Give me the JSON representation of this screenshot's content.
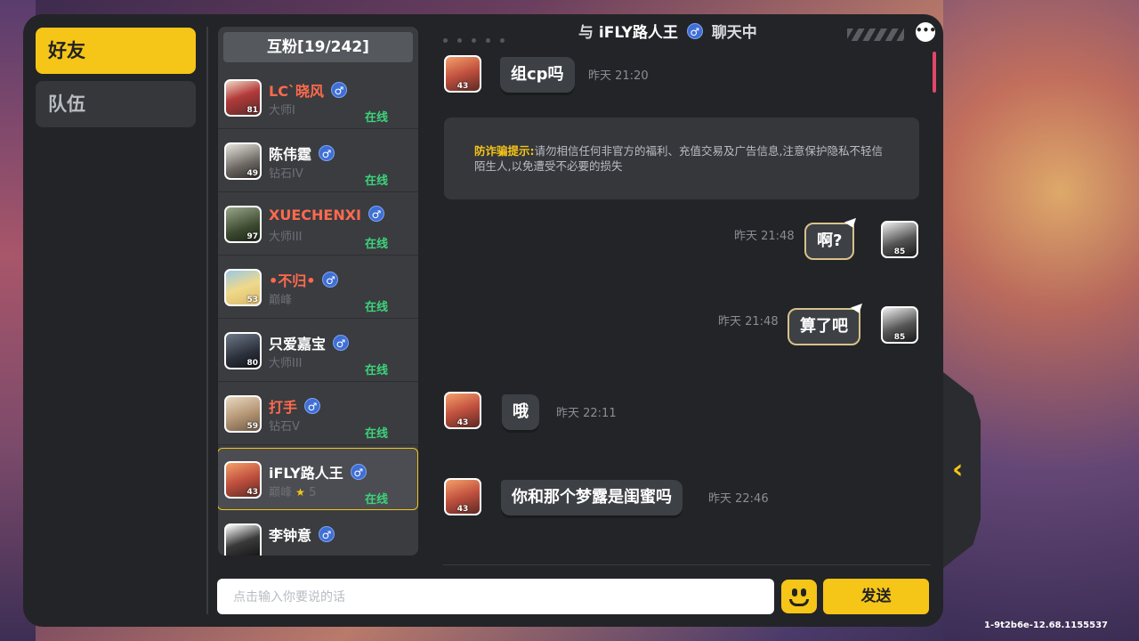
{
  "tabs": {
    "friends": "好友",
    "team": "队伍"
  },
  "friend_list": {
    "header": "互粉[19/242]",
    "friends": [
      {
        "name": "LC`晓风",
        "rank": "大师I",
        "status": "在线",
        "level": "81",
        "name_color": "red",
        "selected": false
      },
      {
        "name": "陈伟霆",
        "rank": "钻石IV",
        "status": "在线",
        "level": "49",
        "name_color": "white",
        "selected": false
      },
      {
        "name": "XUECHENXI",
        "rank": "大师III",
        "status": "在线",
        "level": "97",
        "name_color": "red",
        "selected": false
      },
      {
        "name": "•不归•",
        "rank": "巅峰",
        "status": "在线",
        "level": "53",
        "name_color": "red",
        "selected": false
      },
      {
        "name": "只爱嘉宝",
        "rank": "大师III",
        "status": "在线",
        "level": "80",
        "name_color": "white",
        "selected": false
      },
      {
        "name": "打手",
        "rank": "钻石V",
        "status": "在线",
        "level": "59",
        "name_color": "red",
        "selected": false
      },
      {
        "name": "iFLY路人王",
        "rank": "巅峰",
        "rank_stars": "5",
        "status": "在线",
        "level": "43",
        "name_color": "white",
        "selected": true
      },
      {
        "name": "李钟意",
        "rank": "",
        "status": "",
        "level": "",
        "name_color": "white",
        "selected": false
      }
    ]
  },
  "chat": {
    "title_prefix": "与",
    "partner_name": "iFLY路人王",
    "title_suffix": "聊天中",
    "more_label": "•••",
    "notice_label": "防诈骗提示:",
    "notice_text": "请勿相信任何非官方的福利、充值交易及广告信息,注意保护隐私不轻信陌生人,以免遭受不必要的损失",
    "messages": [
      {
        "side": "left",
        "text": "组cp吗",
        "time": "昨天 21:20",
        "level": "43"
      },
      {
        "side": "right",
        "text": "啊?",
        "time": "昨天 21:48",
        "level": "85"
      },
      {
        "side": "right",
        "text": "算了吧",
        "time": "昨天 21:48",
        "level": "85"
      },
      {
        "side": "left",
        "text": "哦",
        "time": "昨天 22:11",
        "level": "43"
      },
      {
        "side": "left",
        "text": "你和那个梦露是闺蜜吗",
        "time": "昨天 22:46",
        "level": "43"
      }
    ]
  },
  "input": {
    "placeholder": "点击输入你要说的话",
    "send_label": "发送"
  },
  "version": "1-9t2b6e-12.68.1155537",
  "colors": {
    "accent": "#f5c518",
    "online": "#3dd37a",
    "name_highlight": "#ff6a4d",
    "panel": "#232427"
  }
}
